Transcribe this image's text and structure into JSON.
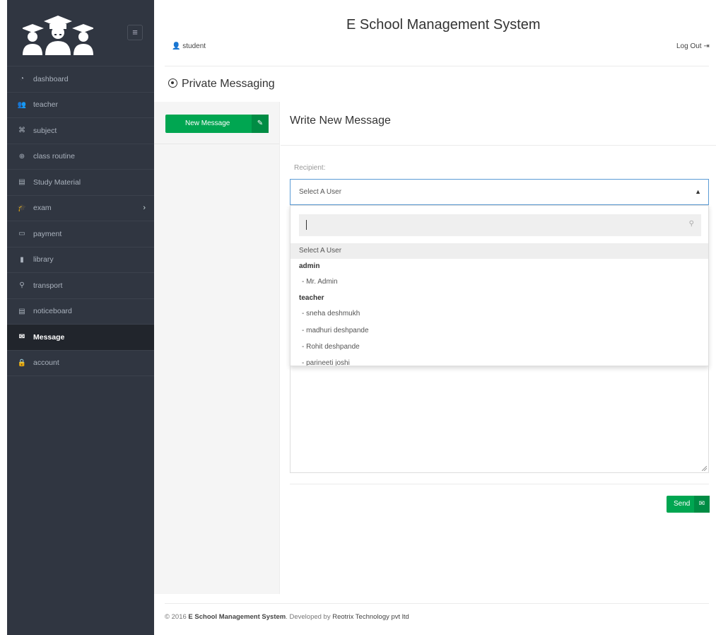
{
  "app_title": "E School Management System",
  "user": {
    "name": "student",
    "logout": "Log Out"
  },
  "sidebar": {
    "items": [
      {
        "label": "dashboard",
        "icon": "gauge-icon",
        "glyph": "◔"
      },
      {
        "label": "teacher",
        "icon": "users-icon",
        "glyph": "👥"
      },
      {
        "label": "subject",
        "icon": "book-icon",
        "glyph": "⌘"
      },
      {
        "label": "class routine",
        "icon": "clock-icon",
        "glyph": "⊕"
      },
      {
        "label": "Study Material",
        "icon": "book-open-icon",
        "glyph": "▤"
      },
      {
        "label": "exam",
        "icon": "graduation-cap-icon",
        "glyph": "🎓"
      },
      {
        "label": "payment",
        "icon": "credit-card-icon",
        "glyph": "▭"
      },
      {
        "label": "library",
        "icon": "library-icon",
        "glyph": "▮"
      },
      {
        "label": "transport",
        "icon": "location-icon",
        "glyph": "⚲"
      },
      {
        "label": "noticeboard",
        "icon": "notice-icon",
        "glyph": "▤"
      },
      {
        "label": "Message",
        "icon": "envelope-icon",
        "glyph": "✉"
      },
      {
        "label": "account",
        "icon": "lock-icon",
        "glyph": "🔒"
      }
    ],
    "active": "Message"
  },
  "page": {
    "title": "Private Messaging"
  },
  "left_panel": {
    "new_message": "New Message"
  },
  "compose": {
    "heading": "Write New Message",
    "recipient_label": "Recipient:",
    "select_value": "Select A User",
    "search_value": "",
    "options": {
      "placeholder": "Select A User",
      "group_admin": "admin",
      "admin_1": "- Mr. Admin",
      "group_teacher": "teacher",
      "teacher_1": "- sneha deshmukh",
      "teacher_2": "- madhuri deshpande",
      "teacher_3": "- Rohit deshpande",
      "teacher_4": "- parineeti joshi"
    },
    "send_label": "Send"
  },
  "footer": {
    "prefix": "© 2016",
    "brand": "E School Management System",
    "suffix": ". Developed by",
    "company": "Reotrix Technology pvt ltd"
  },
  "colors": {
    "sidebar": "#303641",
    "accent": "#00a651",
    "accent_dark": "#008c44",
    "focus": "#5b9bd5"
  }
}
